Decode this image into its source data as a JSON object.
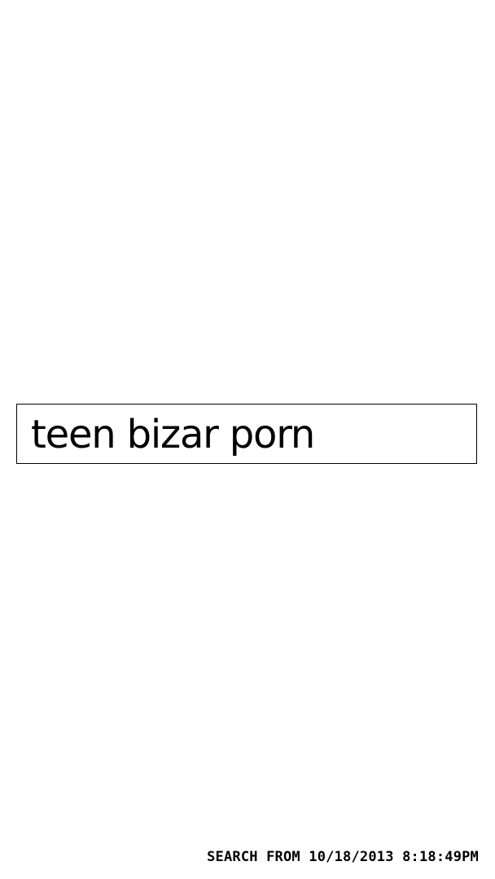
{
  "search": {
    "query": "teen bizar porn"
  },
  "footer": {
    "caption": "SEARCH FROM 10/18/2013 8:18:49PM"
  }
}
